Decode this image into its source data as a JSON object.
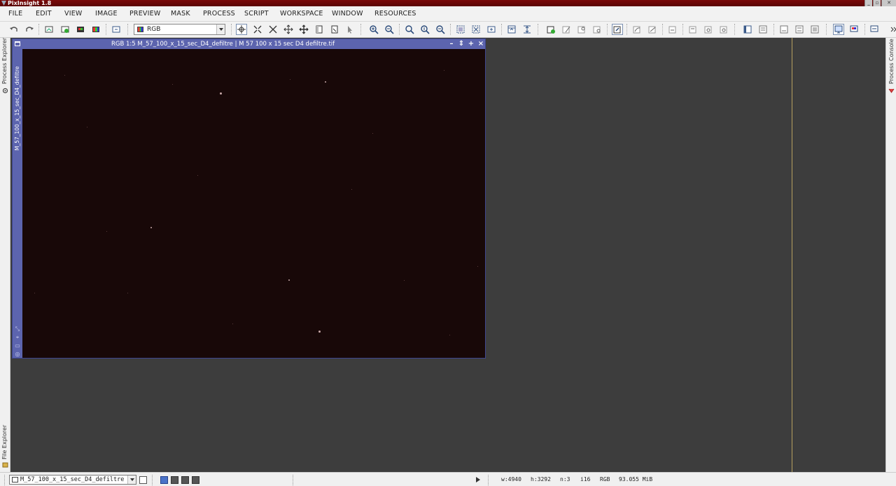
{
  "app": {
    "title": "PixInsight 1.8"
  },
  "menu": [
    "FILE",
    "EDIT",
    "VIEW",
    "IMAGE",
    "PREVIEW",
    "MASK",
    "PROCESS",
    "SCRIPT",
    "WORKSPACE",
    "WINDOW",
    "RESOURCES"
  ],
  "toolbar": {
    "channel_select": "RGB"
  },
  "left_sidebar": {
    "top_tab": "Process Explorer",
    "bottom_tab": "File Explorer"
  },
  "right_sidebar": {
    "top_tab": "Process Console"
  },
  "image_window": {
    "title": "RGB 1:5 M_57_100_x_15_sec_D4_defiltre | M 57 100 x 15 sec D4 defiltre.tif",
    "side_label": "M_57_100_x_15_sec_D4_defiltre",
    "background_color": "#180808"
  },
  "statusbar": {
    "view_select": "M_57_100_x_15_sec_D4_defiltre",
    "width": "w:4940",
    "height": "h:3292",
    "channels": "n:3",
    "sample": "i16",
    "color_space": "RGB",
    "size": "93.055 MiB"
  },
  "colors": {
    "accent": "#5c64ae",
    "title_bar": "#6a0808",
    "workspace": "#3d3d3d"
  }
}
